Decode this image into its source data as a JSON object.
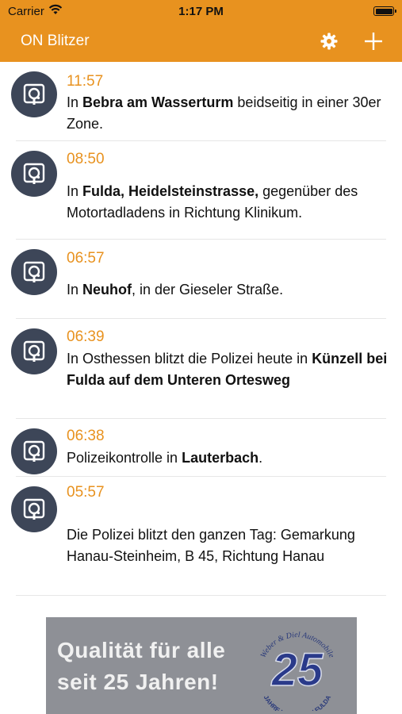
{
  "status_bar": {
    "carrier": "Carrier",
    "time": "1:17 PM"
  },
  "nav": {
    "title": "ON Blitzer"
  },
  "items": [
    {
      "time": "11:57",
      "pre": "In ",
      "b1": "Bebra am Wasserturm",
      "mid": " beidseitig in einer 30er Zone.",
      "b2": "",
      "post": ""
    },
    {
      "time": "08:50",
      "pre": "In ",
      "b1": "Fulda, Heidelsteinstrasse,",
      "mid": " gegenüber des Motortadladens in Richtung Klinikum.",
      "b2": "",
      "post": ""
    },
    {
      "time": "06:57",
      "pre": "In ",
      "b1": "Neuhof",
      "mid": ", in der Gieseler Straße.",
      "b2": "",
      "post": ""
    },
    {
      "time": "06:39",
      "pre": "In Osthessen blitzt die Polizei heute in ",
      "b1": "Künzell",
      "mid": " bei ",
      "b2": "Fulda auf dem Unteren Ortesweg",
      "post": ""
    },
    {
      "time": "06:38",
      "pre": "Polizeikontrolle in ",
      "b1": "Lauterbach",
      "mid": ".",
      "b2": "",
      "post": ""
    },
    {
      "time": "05:57",
      "pre": "Die Polizei blitzt den ganzen Tag: Gemarkung Hanau-Steinheim, B 45, Richtung Hanau",
      "b1": "",
      "mid": "",
      "b2": "",
      "post": ""
    }
  ],
  "ad": {
    "line1": "Qualität für alle",
    "line2": "seit 25 Jahren!",
    "badge_number": "25",
    "badge_top": "Weber & Diel Automobile",
    "badge_bottom": "JAHRE HYUNDAI IN FULDA"
  },
  "icons": {
    "gear": "gear-icon",
    "plus": "plus-icon",
    "camera": "speed-camera-icon",
    "wifi": "wifi-icon",
    "battery": "battery-icon"
  },
  "colors": {
    "accent": "#e8921f",
    "avatar": "#3d4658",
    "time_text": "#e8921f"
  }
}
